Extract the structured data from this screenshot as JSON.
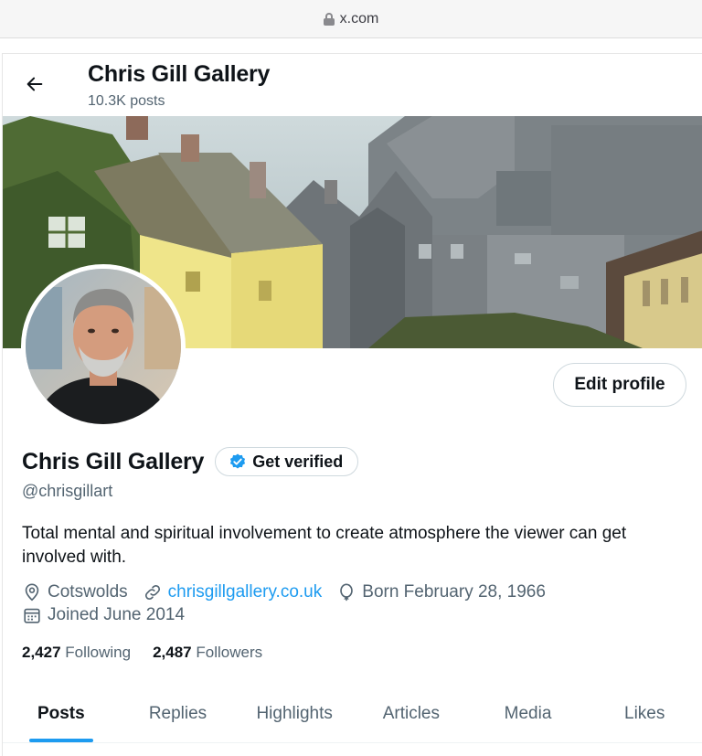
{
  "browser": {
    "url": "x.com"
  },
  "header": {
    "title": "Chris Gill Gallery",
    "posts_count": "10.3K posts"
  },
  "profile": {
    "edit_label": "Edit profile",
    "name": "Chris Gill Gallery",
    "verify_label": "Get verified",
    "handle": "@chrisgillart",
    "bio": "Total mental and spiritual involvement to create atmosphere the viewer can get involved with.",
    "location": "Cotswolds",
    "website": "chrisgillgallery.co.uk",
    "birthday": "Born February 28, 1966",
    "joined": "Joined June 2014",
    "following_count": "2,427",
    "following_label": "Following",
    "followers_count": "2,487",
    "followers_label": "Followers"
  },
  "tabs": [
    {
      "label": "Posts"
    },
    {
      "label": "Replies"
    },
    {
      "label": "Highlights"
    },
    {
      "label": "Articles"
    },
    {
      "label": "Media"
    },
    {
      "label": "Likes"
    }
  ],
  "colors": {
    "accent": "#1d9bf0",
    "text": "#0f1419",
    "muted": "#536471",
    "border": "#cfd9de"
  }
}
